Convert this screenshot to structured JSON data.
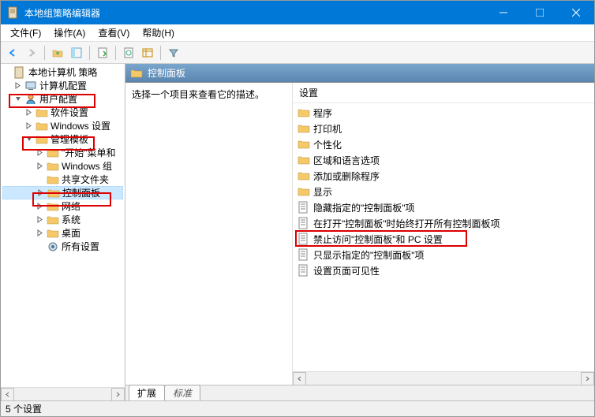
{
  "title": "本地组策略编辑器",
  "menu": {
    "file": "文件(F)",
    "action": "操作(A)",
    "view": "查看(V)",
    "help": "帮助(H)"
  },
  "tree": {
    "root": "本地计算机 策略",
    "computer_config": "计算机配置",
    "user_config": "用户配置",
    "software": "软件设置",
    "windows_settings": "Windows 设置",
    "admin_templates": "管理模板",
    "start_menu": "\"开始\"菜单和",
    "windows_comp": "Windows 组",
    "shared_folders": "共享文件夹",
    "control_panel": "控制面板",
    "network": "网络",
    "system": "系统",
    "desktop": "桌面",
    "all_settings": "所有设置"
  },
  "content": {
    "header": "控制面板",
    "desc_prompt": "选择一个项目来查看它的描述。",
    "settings_label": "设置",
    "items": {
      "programs": "程序",
      "printers": "打印机",
      "personalization": "个性化",
      "region_lang": "区域和语言选项",
      "add_remove": "添加或删除程序",
      "display": "显示",
      "hide_specified": "隐藏指定的\"控制面板\"项",
      "always_open": "在打开\"控制面板\"时始终打开所有控制面板项",
      "prohibit_access": "禁止访问\"控制面板\"和 PC 设置",
      "show_only": "只显示指定的\"控制面板\"项",
      "page_visibility": "设置页面可见性"
    }
  },
  "tabs": {
    "extended": "扩展",
    "standard": "标准"
  },
  "status": "5 个设置"
}
